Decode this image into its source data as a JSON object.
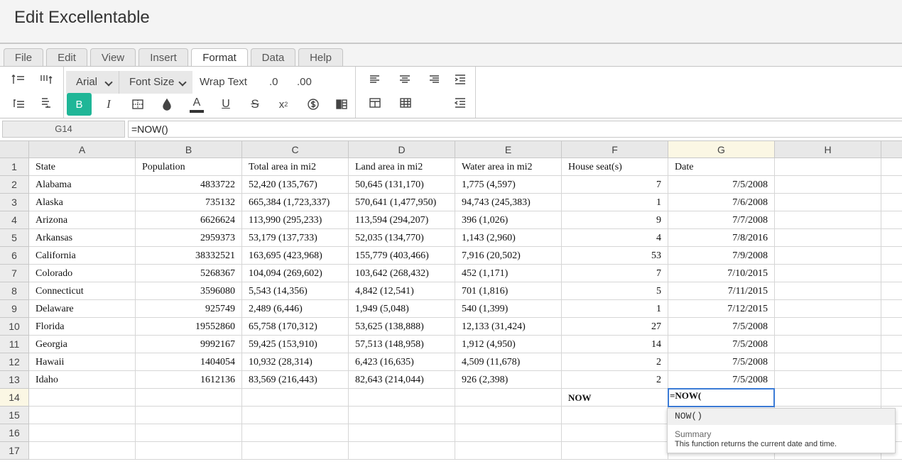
{
  "title": "Edit Excellentable",
  "menu_tabs": [
    "File",
    "Edit",
    "View",
    "Insert",
    "Format",
    "Data",
    "Help"
  ],
  "active_tab": "Format",
  "toolbar": {
    "font_family": "Arial",
    "font_size": "Font Size",
    "wrap_text": "Wrap Text",
    "decrease_decimal": ".0",
    "increase_decimal": ".00",
    "bold_active_color": "#1fb697",
    "icons": [
      "insert-row-above-icon",
      "insert-column-right-icon",
      "delete-row-icon",
      "delete-column-icon",
      "bold-icon",
      "italic-icon",
      "cell-border-icon",
      "fill-color-icon",
      "font-color-icon",
      "underline-icon",
      "strikethrough-icon",
      "superscript-icon",
      "currency-icon",
      "conditional-format-icon",
      "align-left-icon",
      "align-center-icon",
      "align-right-icon",
      "indent-icon",
      "merge-cells-icon",
      "table-icon",
      "outdent-icon"
    ]
  },
  "formula_bar": {
    "cell_ref": "G14",
    "formula": "=NOW()"
  },
  "sheet": {
    "columns": [
      "A",
      "B",
      "C",
      "D",
      "E",
      "F",
      "G",
      "H"
    ],
    "selected_column": "G",
    "selected_row": "14",
    "header": [
      "State",
      "Population",
      "Total area in mi2",
      "Land area in mi2",
      "Water area in mi2",
      "House seat(s)",
      "Date",
      ""
    ],
    "rows": [
      [
        "Alabama",
        "4833722",
        "52,420 (135,767)",
        "50,645 (131,170)",
        "1,775 (4,597)",
        "7",
        "7/5/2008"
      ],
      [
        "Alaska",
        "735132",
        "665,384 (1,723,337)",
        "570,641 (1,477,950)",
        "94,743 (245,383)",
        "1",
        "7/6/2008"
      ],
      [
        "Arizona",
        "6626624",
        "113,990 (295,233)",
        "113,594 (294,207)",
        "396 (1,026)",
        "9",
        "7/7/2008"
      ],
      [
        "Arkansas",
        "2959373",
        "53,179 (137,733)",
        "52,035 (134,770)",
        "1,143 (2,960)",
        "4",
        "7/8/2016"
      ],
      [
        "California",
        "38332521",
        "163,695 (423,968)",
        "155,779 (403,466)",
        "7,916 (20,502)",
        "53",
        "7/9/2008"
      ],
      [
        "Colorado",
        "5268367",
        "104,094 (269,602)",
        "103,642 (268,432)",
        "452 (1,171)",
        "7",
        "7/10/2015"
      ],
      [
        "Connecticut",
        "3596080",
        "5,543 (14,356)",
        "4,842 (12,541)",
        "701 (1,816)",
        "5",
        "7/11/2015"
      ],
      [
        "Delaware",
        "925749",
        "2,489 (6,446)",
        "1,949 (5,048)",
        "540 (1,399)",
        "1",
        "7/12/2015"
      ],
      [
        "Florida",
        "19552860",
        "65,758 (170,312)",
        "53,625 (138,888)",
        "12,133 (31,424)",
        "27",
        "7/5/2008"
      ],
      [
        "Georgia",
        "9992167",
        "59,425 (153,910)",
        "57,513 (148,958)",
        "1,912 (4,950)",
        "14",
        "7/5/2008"
      ],
      [
        "Hawaii",
        "1404054",
        "10,932 (28,314)",
        "6,423 (16,635)",
        "4,509 (11,678)",
        "2",
        "7/5/2008"
      ],
      [
        "Idaho",
        "1612136",
        "83,569 (216,443)",
        "82,643 (214,044)",
        "926 (2,398)",
        "2",
        "7/5/2008"
      ]
    ],
    "row_numbers": [
      "1",
      "2",
      "3",
      "4",
      "5",
      "6",
      "7",
      "8",
      "9",
      "10",
      "11",
      "12",
      "13",
      "14",
      "15",
      "16",
      "17"
    ],
    "f14_label": "NOW",
    "g14_edit": "=NOW("
  },
  "autocomplete": {
    "function": "NOW()",
    "summary_label": "Summary",
    "description": "This function returns the current date and time."
  }
}
